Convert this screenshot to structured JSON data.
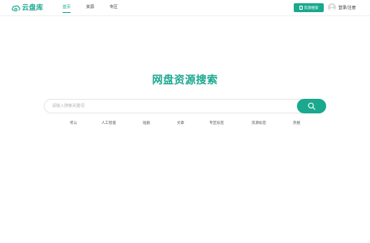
{
  "header": {
    "logo_text": "云盘库",
    "nav": [
      {
        "label": "首页",
        "active": true
      },
      {
        "label": "资源",
        "active": false
      },
      {
        "label": "专区",
        "active": false
      }
    ],
    "resource_button_label": "资源搜索",
    "login_label": "登录/注册"
  },
  "main": {
    "title": "网盘资源搜索",
    "search": {
      "placeholder": "请输入搜索关键词",
      "button_icon": "search-icon"
    },
    "tags": [
      "考公",
      "人工智能",
      "短剧",
      "文章",
      "专区标签",
      "资源标签",
      "热搜"
    ]
  },
  "colors": {
    "accent": "#1aa88f",
    "background": "#ffffff",
    "text": "#333333"
  }
}
